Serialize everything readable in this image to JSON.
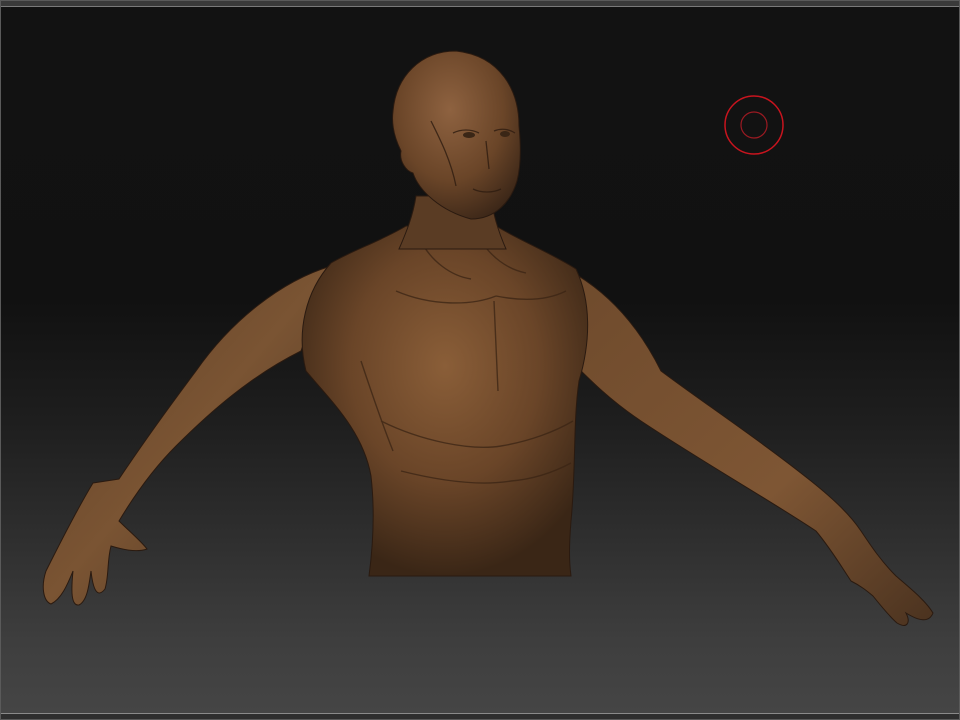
{
  "canvas": {
    "background_top": "#121212",
    "background_bottom": "#464646"
  },
  "model": {
    "subject": "sculpted-human-torso",
    "material_color": "#7a5230"
  },
  "brush": {
    "icon": "brush-cursor-icon",
    "color": "#c8141e"
  }
}
